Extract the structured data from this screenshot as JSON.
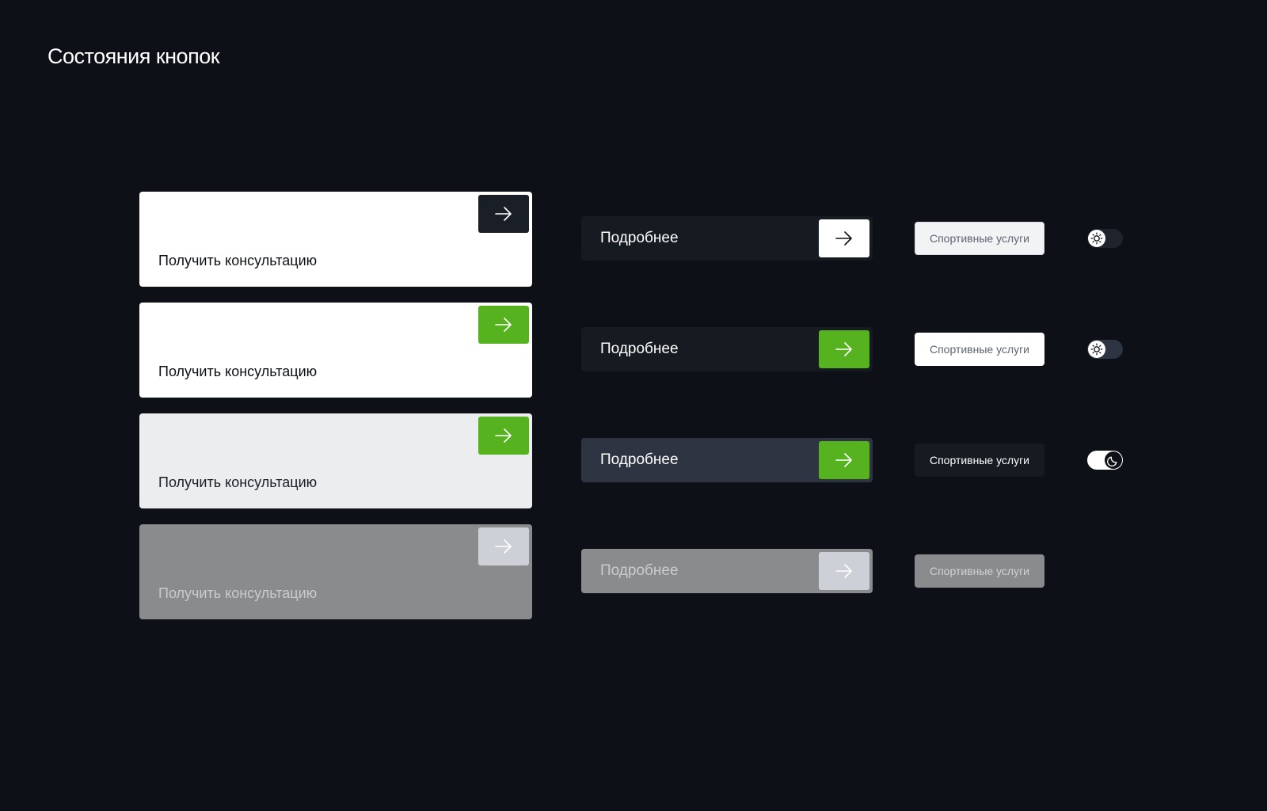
{
  "page": {
    "title": "Состояния кнопок"
  },
  "cta_label": "Получить консультацию",
  "more_label": "Подробнее",
  "chip_label": "Спортивные услуги",
  "states": [
    {
      "cta": {
        "bg": "#ffffff",
        "text": "#0d1016",
        "arrow_bg": "#1a1e26",
        "arrow_color": "#ffffff"
      },
      "more": {
        "bg": "#161a21",
        "text": "#ffffff",
        "arrow_bg": "#ffffff",
        "arrow_color": "#0d1016"
      },
      "chip": {
        "bg": "#f2f3f5",
        "text": "#5d6470",
        "border": "#d8dbe0"
      },
      "toggle": {
        "track": "#1e232c",
        "knob": "#ffffff",
        "icon": "sun-icon",
        "knob_side": "left"
      }
    },
    {
      "cta": {
        "bg": "#ffffff",
        "text": "#0d1016",
        "arrow_bg": "#56b31f",
        "arrow_color": "#ffffff"
      },
      "more": {
        "bg": "#161a21",
        "text": "#ffffff",
        "arrow_bg": "#56b31f",
        "arrow_color": "#ffffff"
      },
      "chip": {
        "bg": "#ffffff",
        "text": "#5d6470",
        "border": "#ffffff"
      },
      "toggle": {
        "track": "#2e3441",
        "knob": "#ffffff",
        "icon": "sun-icon",
        "knob_side": "left"
      }
    },
    {
      "cta": {
        "bg": "#ecedef",
        "text": "#1a1e26",
        "arrow_bg": "#56b31f",
        "arrow_color": "#ffffff"
      },
      "more": {
        "bg": "#2e3441",
        "text": "#ffffff",
        "arrow_bg": "#56b31f",
        "arrow_color": "#ffffff"
      },
      "chip": {
        "bg": "#161a21",
        "text": "#ffffff",
        "border": "#161a21"
      },
      "toggle": {
        "track": "#ffffff",
        "knob": "#0d1016",
        "icon": "moon-icon",
        "knob_side": "right"
      }
    },
    {
      "cta": {
        "bg": "#8a8b8d",
        "text": "#c9cbcf",
        "arrow_bg": "#cdd0d6",
        "arrow_color": "#ffffff"
      },
      "more": {
        "bg": "#8a8b8d",
        "text": "#c9cbcf",
        "arrow_bg": "#cdd0d6",
        "arrow_color": "#ffffff"
      },
      "chip": {
        "bg": "#8a8b8d",
        "text": "#d0d2d6",
        "border": "#8a8b8d"
      },
      "toggle": null
    }
  ]
}
